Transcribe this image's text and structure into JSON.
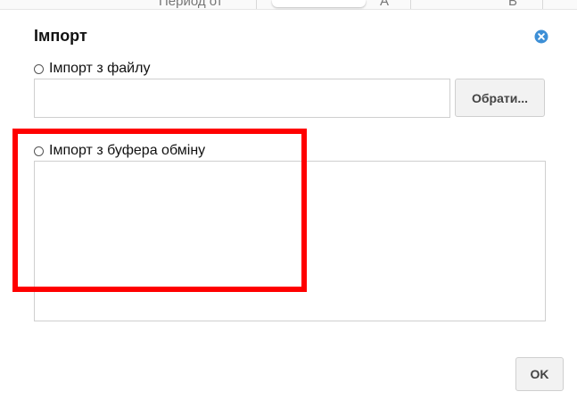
{
  "background_table": {
    "cells": [
      "Период от",
      "А",
      "В"
    ]
  },
  "dialog": {
    "title": "Імпорт",
    "close_icon": "close-circle-icon",
    "option_file": {
      "label": "Імпорт з файлу",
      "selected": false
    },
    "file_input": {
      "value": "",
      "placeholder": ""
    },
    "browse_label": "Обрати...",
    "option_clipboard": {
      "label": "Імпорт з буфера обміну",
      "selected": false
    },
    "clipboard_text": "",
    "ok_label": "OK"
  },
  "colors": {
    "accent": "#3d8fd6",
    "highlight": "#ff0000",
    "border": "#cfcfcf",
    "button_bg": "#f2f2f2"
  }
}
